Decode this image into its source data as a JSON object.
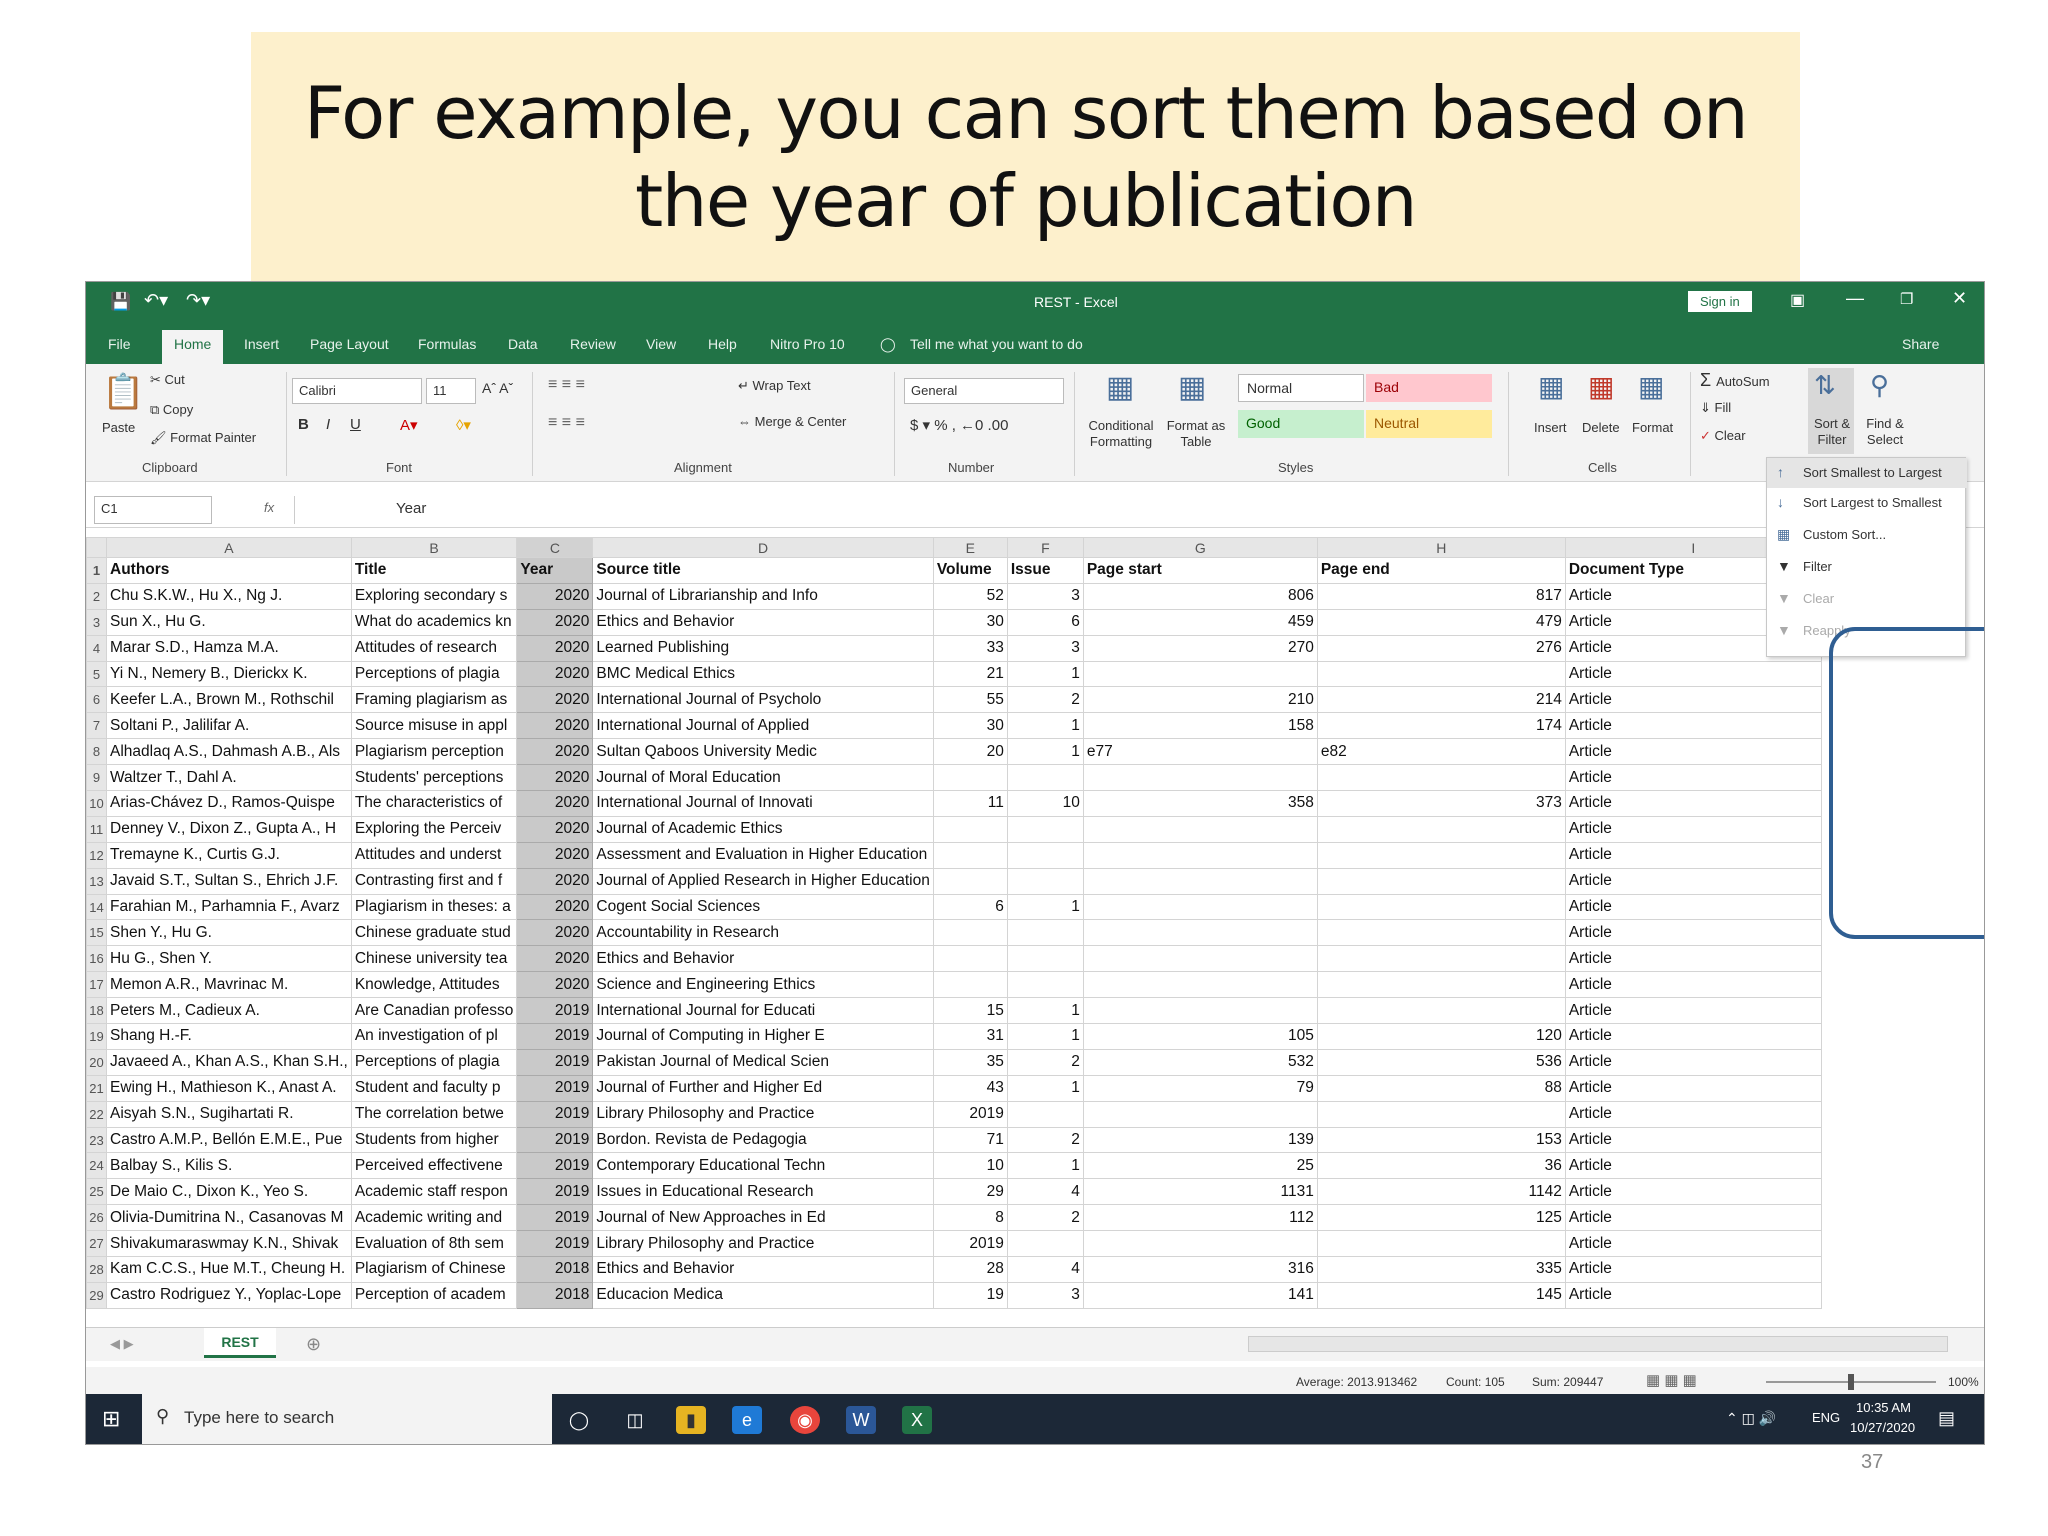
{
  "slide": {
    "title_line1": "For example, you can sort them based on",
    "title_line2": "the year of publication",
    "page_number": "37"
  },
  "window": {
    "title": "REST  -  Excel",
    "sign_in": "Sign in",
    "share": "Share"
  },
  "tabs": [
    "File",
    "Home",
    "Insert",
    "Page Layout",
    "Formulas",
    "Data",
    "Review",
    "View",
    "Help",
    "Nitro Pro 10"
  ],
  "tell_me": "Tell me what you want to do",
  "ribbon": {
    "clipboard": {
      "paste": "Paste",
      "cut": "Cut",
      "copy": "Copy",
      "format_painter": "Format Painter",
      "group": "Clipboard"
    },
    "font": {
      "name": "Calibri",
      "size": "11",
      "group": "Font"
    },
    "alignment": {
      "wrap_text": "Wrap Text",
      "merge_center": "Merge & Center",
      "group": "Alignment"
    },
    "number": {
      "format": "General",
      "group": "Number"
    },
    "styles": {
      "conditional": "Conditional Formatting",
      "format_table": "Format as Table",
      "normal": "Normal",
      "bad": "Bad",
      "good": "Good",
      "neutral": "Neutral",
      "group": "Styles"
    },
    "cells": {
      "insert": "Insert",
      "delete": "Delete",
      "format": "Format",
      "group": "Cells"
    },
    "editing": {
      "autosum": "AutoSum",
      "fill": "Fill",
      "clear": "Clear",
      "sort_filter": "Sort & Filter",
      "find_select": "Find & Select"
    }
  },
  "sort_menu": [
    "Sort Smallest to Largest",
    "Sort Largest to Smallest",
    "Custom Sort...",
    "Filter",
    "Clear",
    "Reapply"
  ],
  "formula_bar": {
    "name_box": "C1",
    "fx": "fx",
    "content": "Year"
  },
  "columns": [
    "A",
    "B",
    "C",
    "D",
    "E",
    "F",
    "G",
    "H",
    "I"
  ],
  "headers": [
    "Authors",
    "Title",
    "Year",
    "Source title",
    "Volume",
    "Issue",
    "Page start",
    "Page end",
    "Document Type"
  ],
  "rows": [
    [
      "Chu S.K.W., Hu X., Ng J.",
      "Exploring secondary s",
      "2020",
      "Journal of Librarianship and Info",
      "52",
      "3",
      "806",
      "817",
      "Article"
    ],
    [
      "Sun X., Hu G.",
      "What do academics kn",
      "2020",
      "Ethics and Behavior",
      "30",
      "6",
      "459",
      "479",
      "Article"
    ],
    [
      "Marar S.D., Hamza M.A.",
      "Attitudes of research",
      "2020",
      "Learned Publishing",
      "33",
      "3",
      "270",
      "276",
      "Article"
    ],
    [
      "Yi N., Nemery B., Dierickx K.",
      "Perceptions of plagia",
      "2020",
      "BMC Medical Ethics",
      "21",
      "1",
      "",
      "",
      "Article"
    ],
    [
      "Keefer L.A., Brown M., Rothschil",
      "Framing plagiarism as",
      "2020",
      "International Journal of Psycholo",
      "55",
      "2",
      "210",
      "214",
      "Article"
    ],
    [
      "Soltani P., Jalilifar A.",
      "Source misuse in appl",
      "2020",
      "International Journal of Applied",
      "30",
      "1",
      "158",
      "174",
      "Article"
    ],
    [
      "Alhadlaq A.S., Dahmash A.B., Als",
      "Plagiarism perception",
      "2020",
      "Sultan Qaboos University Medic",
      "20",
      "1",
      "e77",
      "e82",
      "Article"
    ],
    [
      "Waltzer T., Dahl A.",
      "Students' perceptions",
      "2020",
      "Journal of Moral Education",
      "",
      "",
      "",
      "",
      "Article"
    ],
    [
      "Arias-Chávez D., Ramos-Quispe",
      "The characteristics of",
      "2020",
      "International Journal of Innovati",
      "11",
      "10",
      "358",
      "373",
      "Article"
    ],
    [
      "Denney V., Dixon Z., Gupta A., H",
      "Exploring the Perceiv",
      "2020",
      "Journal of Academic Ethics",
      "",
      "",
      "",
      "",
      "Article"
    ],
    [
      "Tremayne K., Curtis G.J.",
      "Attitudes and underst",
      "2020",
      "Assessment and Evaluation in Higher Education",
      "",
      "",
      "",
      "",
      "Article"
    ],
    [
      "Javaid S.T., Sultan S., Ehrich J.F.",
      "Contrasting first and f",
      "2020",
      "Journal of Applied Research in Higher Education",
      "",
      "",
      "",
      "",
      "Article"
    ],
    [
      "Farahian M., Parhamnia F., Avarz",
      "Plagiarism in theses: a",
      "2020",
      "Cogent Social Sciences",
      "6",
      "1",
      "",
      "",
      "Article"
    ],
    [
      "Shen Y., Hu G.",
      "Chinese graduate stud",
      "2020",
      "Accountability in Research",
      "",
      "",
      "",
      "",
      "Article"
    ],
    [
      "Hu G., Shen Y.",
      "Chinese university tea",
      "2020",
      "Ethics and Behavior",
      "",
      "",
      "",
      "",
      "Article"
    ],
    [
      "Memon A.R., Mavrinac M.",
      "Knowledge, Attitudes",
      "2020",
      "Science and Engineering Ethics",
      "",
      "",
      "",
      "",
      "Article"
    ],
    [
      "Peters M., Cadieux A.",
      "Are Canadian professo",
      "2019",
      "International Journal for Educati",
      "15",
      "1",
      "",
      "",
      "Article"
    ],
    [
      "Shang H.-F.",
      "An investigation of pl",
      "2019",
      "Journal of Computing in Higher E",
      "31",
      "1",
      "105",
      "120",
      "Article"
    ],
    [
      "Javaeed A., Khan A.S., Khan S.H.,",
      "Perceptions of plagia",
      "2019",
      "Pakistan Journal of Medical Scien",
      "35",
      "2",
      "532",
      "536",
      "Article"
    ],
    [
      "Ewing H., Mathieson K., Anast A.",
      "Student and faculty p",
      "2019",
      "Journal of Further and Higher Ed",
      "43",
      "1",
      "79",
      "88",
      "Article"
    ],
    [
      "Aisyah S.N., Sugihartati R.",
      "The correlation betwe",
      "2019",
      "Library Philosophy and Practice",
      "2019",
      "",
      "",
      "",
      "Article"
    ],
    [
      "Castro A.M.P., Bellón E.M.E., Pue",
      "Students from higher",
      "2019",
      "Bordon. Revista de Pedagogia",
      "71",
      "2",
      "139",
      "153",
      "Article"
    ],
    [
      "Balbay S., Kilis S.",
      "Perceived effectivene",
      "2019",
      "Contemporary Educational Techn",
      "10",
      "1",
      "25",
      "36",
      "Article"
    ],
    [
      "De Maio C., Dixon K., Yeo S.",
      "Academic staff respon",
      "2019",
      "Issues in Educational Research",
      "29",
      "4",
      "1131",
      "1142",
      "Article"
    ],
    [
      "Olivia-Dumitrina N., Casanovas M",
      "Academic writing and",
      "2019",
      "Journal of New Approaches in Ed",
      "8",
      "2",
      "112",
      "125",
      "Article"
    ],
    [
      "Shivakumaraswmay K.N., Shivak",
      "Evaluation of 8th sem",
      "2019",
      "Library Philosophy and Practice",
      "2019",
      "",
      "",
      "",
      "Article"
    ],
    [
      "Kam C.C.S., Hue M.T., Cheung H.",
      "Plagiarism of Chinese",
      "2018",
      "Ethics and Behavior",
      "28",
      "4",
      "316",
      "335",
      "Article"
    ],
    [
      "Castro Rodriguez Y., Yoplac-Lope",
      "Perception of academ",
      "2018",
      "Educacion Medica",
      "19",
      "3",
      "141",
      "145",
      "Article"
    ]
  ],
  "sheet_tab": "REST",
  "status": {
    "average": "Average: 2013.913462",
    "count": "Count: 105",
    "sum": "Sum: 209447",
    "zoom": "100%"
  },
  "taskbar": {
    "search": "Type here to search",
    "lang": "ENG",
    "time": "10:35 AM",
    "date": "10/27/2020"
  }
}
